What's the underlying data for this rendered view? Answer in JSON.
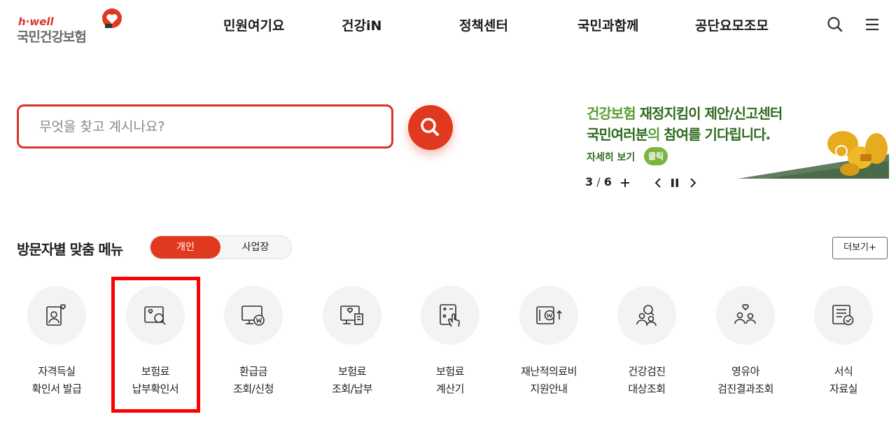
{
  "header": {
    "logo_small": "h·well",
    "logo_main": "국민건강보험",
    "nav": [
      "민원여기요",
      "건강iN",
      "정책센터",
      "국민과함께",
      "공단요모조모"
    ],
    "icons": [
      "search-icon",
      "hamburger-menu-icon"
    ]
  },
  "search": {
    "placeholder": "무엇을 찾고 계시나요?",
    "button_icon": "search-icon"
  },
  "banner": {
    "line1_a": "건강보험 ",
    "line1_b": "재정지킴이 제안/신고센터",
    "line2_a": "국민여러분",
    "line2_b": "의 ",
    "line2_c": "참여를 기다립니다.",
    "more": "자세히 보기",
    "click": "클릭",
    "current": "3",
    "total": "6",
    "controls": [
      "plus-icon",
      "chevron-left-icon",
      "pause-icon",
      "chevron-right-icon"
    ]
  },
  "menu": {
    "title": "방문자별 맞춤 메뉴",
    "toggle": [
      "개인",
      "사업장"
    ],
    "more_label": "더보기+",
    "items": [
      {
        "line1": "자격득실",
        "line2": "확인서 발급",
        "icon": "id-card-heart-icon"
      },
      {
        "line1": "보험료",
        "line2": "납부확인서",
        "icon": "card-search-icon"
      },
      {
        "line1": "환급금",
        "line2": "조회/신청",
        "icon": "monitor-won-icon"
      },
      {
        "line1": "보험료",
        "line2": "조회/납부",
        "icon": "monitor-heart-doc-icon"
      },
      {
        "line1": "보험료",
        "line2": "계산기",
        "icon": "calculator-hand-icon"
      },
      {
        "line1": "재난적의료비",
        "line2": "지원안내",
        "icon": "card-won-arrow-icon"
      },
      {
        "line1": "건강검진",
        "line2": "대상조회",
        "icon": "people-search-icon"
      },
      {
        "line1": "영유아",
        "line2": "검진결과조회",
        "icon": "family-heart-icon"
      },
      {
        "line1": "서식",
        "line2": "자료실",
        "icon": "document-check-icon"
      }
    ]
  },
  "colors": {
    "brand_red": "#e0391f",
    "highlight": "#ff0000",
    "banner_green": "#5b9e35",
    "banner_dark_green": "#2f6b1f"
  }
}
